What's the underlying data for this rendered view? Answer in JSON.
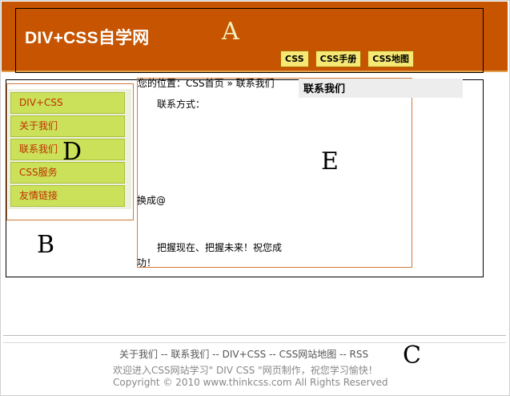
{
  "header": {
    "site_title": "DIV+CSS自学网",
    "region_label": "A",
    "nav": [
      "CSS",
      "CSS手册",
      "CSS地图"
    ]
  },
  "sidebar": {
    "region_label": "B",
    "inner_label": "D",
    "items": [
      "DIV+CSS",
      "关于我们",
      "联系我们",
      "CSS服务",
      "友情链接"
    ]
  },
  "content": {
    "region_label": "E",
    "breadcrumb": {
      "prefix": "您的位置：",
      "home": "CSS首页",
      "separator": " » ",
      "current": "联系我们"
    },
    "title": "联系我们",
    "contact_label": "联系方式：",
    "contact_line": "换成@",
    "slogan": "把握现在、把握未来！祝您成功！"
  },
  "footer": {
    "region_label": "C",
    "links": [
      "关于我们",
      "联系我们",
      "DIV+CSS",
      "CSS网站地图",
      "RSS"
    ],
    "link_separator": " -- ",
    "welcome": "欢迎进入CSS网站学习\" DIV CSS \"网页制作，祝您学习愉快！",
    "copyright": "Copyright © 2010    www.thinkcss.com    All Rights Reserved"
  },
  "colors": {
    "header_bg": "#c65400",
    "nav_button_bg": "#f6e875",
    "sidebar_item_bg": "#cbe15a",
    "sidebar_item_text": "#c02d00",
    "content_border": "#d07a3a"
  }
}
